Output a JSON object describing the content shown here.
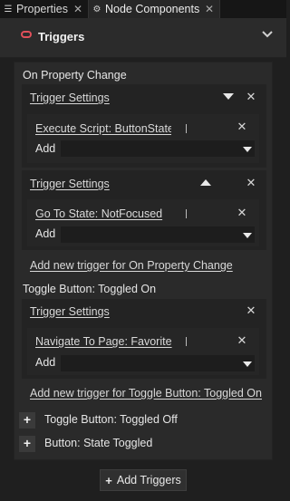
{
  "tabs": [
    {
      "icon": "list-icon",
      "label": "Properties",
      "close": "✕"
    },
    {
      "icon": "node-components-icon",
      "label": "Node Components",
      "close": "✕"
    }
  ],
  "header": {
    "title": "Triggers",
    "chevron": "⌄"
  },
  "triggers": [
    {
      "name": "On Property Change",
      "settings": [
        {
          "label": "Trigger Settings",
          "actions": [
            {
              "label": "Execute Script: ButtonState.js"
            }
          ],
          "add_label": "Add"
        },
        {
          "label": "Trigger Settings",
          "actions": [
            {
              "label": "Go To State: NotFocused"
            }
          ],
          "add_label": "Add"
        }
      ],
      "add_new": "Add new trigger for On Property Change"
    },
    {
      "name": "Toggle Button: Toggled On",
      "settings": [
        {
          "label": "Trigger Settings",
          "actions": [
            {
              "label": "Navigate To Page: Favorite"
            }
          ],
          "add_label": "Add"
        }
      ],
      "add_new": "Add new trigger for Toggle Button: Toggled On"
    }
  ],
  "collapsed_triggers": [
    {
      "name": "Toggle Button: Toggled Off"
    },
    {
      "name": "Button: State Toggled"
    }
  ],
  "footer": {
    "add_triggers": "Add Triggers",
    "plus": "+"
  },
  "glyphs": {
    "close": "✕",
    "plus": "+"
  },
  "colors": {
    "accent": "#e0505a",
    "background": "#1f1f1f",
    "panel": "#2a2a2a"
  }
}
